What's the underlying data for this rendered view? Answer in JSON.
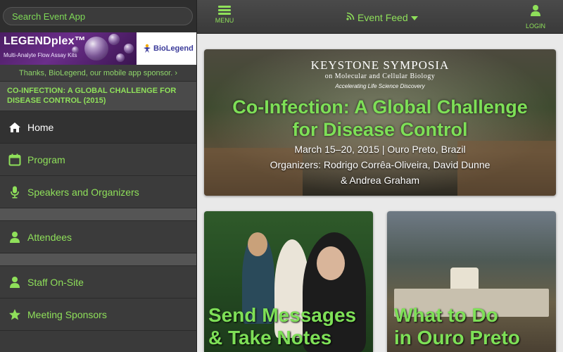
{
  "search": {
    "placeholder": "Search Event App"
  },
  "sponsor": {
    "product_title": "LEGENDplex™",
    "product_subtitle": "Multi-Analyte Flow Assay Kits",
    "company": "BioLegend",
    "thanks_text": "Thanks, BioLegend, our mobile app sponsor. ›"
  },
  "event": {
    "title": "CO-INFECTION: A GLOBAL CHALLENGE FOR DISEASE CONTROL (2015)"
  },
  "nav": {
    "items": [
      {
        "label": "Home",
        "icon": "home-icon"
      },
      {
        "label": "Program",
        "icon": "calendar-icon"
      },
      {
        "label": "Speakers and Organizers",
        "icon": "microphone-icon"
      },
      {
        "label": "Attendees",
        "icon": "person-icon"
      },
      {
        "label": "Staff On-Site",
        "icon": "person-icon"
      },
      {
        "label": "Meeting Sponsors",
        "icon": "star-icon"
      }
    ]
  },
  "topbar": {
    "menu_label": "MENU",
    "feed_label": "Event Feed",
    "login_label": "LOGIN"
  },
  "hero": {
    "org_name": "KEYSTONE SYMPOSIA",
    "org_sub": "on Molecular and Cellular Biology",
    "tagline": "Accelerating Life Science Discovery",
    "headline_1": "Co-Infection: A Global Challenge",
    "headline_2": "for Disease Control",
    "dates": "March 15–20, 2015 | Ouro Preto, Brazil",
    "organizers_1": "Organizers: Rodrigo Corrêa-Oliveira, David Dunne",
    "organizers_2": "& Andrea Graham"
  },
  "tiles": {
    "messages_line1": "Send Messages",
    "messages_line2": "& Take Notes",
    "todo_line1": "What to Do",
    "todo_line2": "in Ouro Preto"
  },
  "colors": {
    "accent_green": "#8fe05a",
    "sidebar_bg": "#3a3a3a",
    "sponsor_purple": "#4b1d63"
  }
}
